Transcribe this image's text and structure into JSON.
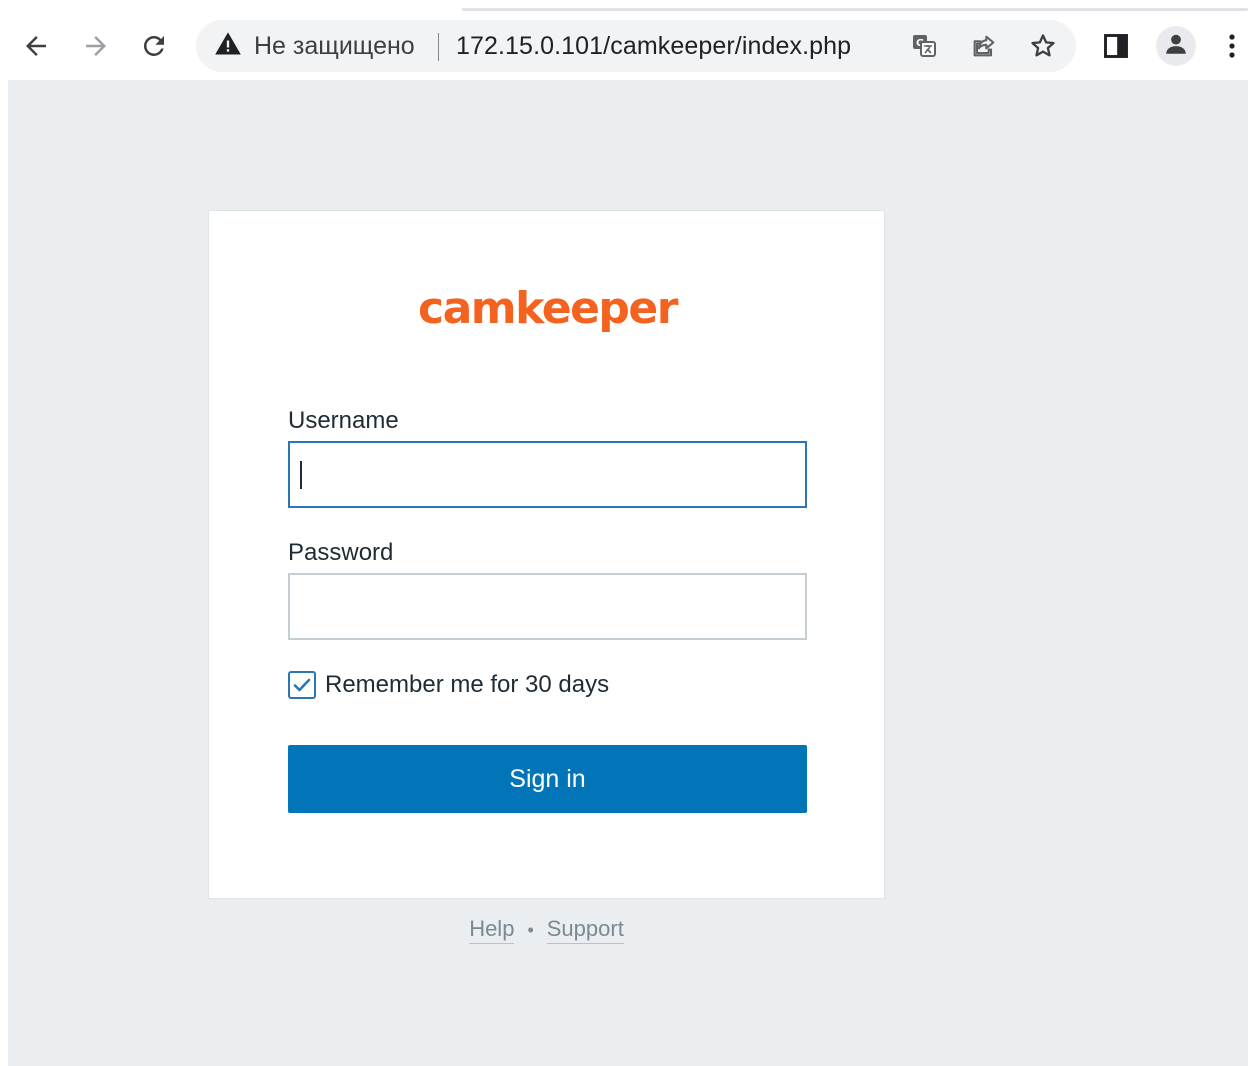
{
  "browser": {
    "security_label": "Не защищено",
    "url": "172.15.0.101/camkeeper/index.php",
    "icons": {
      "back": "arrow-left-icon",
      "forward": "arrow-right-icon",
      "reload": "reload-icon",
      "security": "warning-triangle-icon",
      "translate": "translate-icon",
      "share": "share-icon",
      "bookmark": "star-icon",
      "side_panel": "side-panel-icon",
      "profile": "profile-icon",
      "menu": "kebab-menu-icon"
    }
  },
  "login": {
    "logo_text": "camkeeper",
    "username_label": "Username",
    "username_value": "",
    "password_label": "Password",
    "password_value": "",
    "remember_label": "Remember me for 30 days",
    "remember_checked": true,
    "signin_label": "Sign in"
  },
  "footer": {
    "help_label": "Help",
    "separator": "•",
    "support_label": "Support"
  },
  "colors": {
    "brand": "#f4621f",
    "primary_button": "#0275b8",
    "focus_border": "#2c76b6",
    "page_background": "#ebeef0"
  }
}
